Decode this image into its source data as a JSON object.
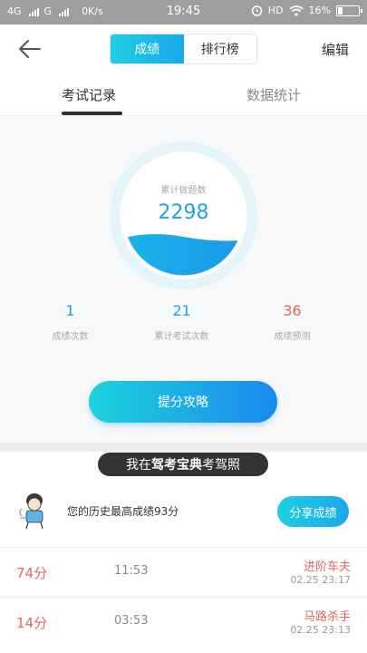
{
  "status": {
    "net1": "4G",
    "net2": "G",
    "speed": "0K/s",
    "time": "19:45",
    "hd": "HD",
    "battery": "16%"
  },
  "header": {
    "tab_scores": "成绩",
    "tab_rank": "排行榜",
    "edit": "编辑"
  },
  "tabs": {
    "exam_records": "考试记录",
    "statistics": "数据统计"
  },
  "gauge": {
    "label": "累计做题数",
    "value": "2298"
  },
  "stats": [
    {
      "value": "1",
      "label": "成绩次数"
    },
    {
      "value": "21",
      "label": "累计考试次数"
    },
    {
      "value": "36",
      "label": "成绩预测"
    }
  ],
  "tips_button": "提分攻略",
  "banner": {
    "prefix": "我在",
    "brand": "驾考宝典",
    "suffix": "考驾照"
  },
  "best": {
    "text": "您的历史最高成绩93分",
    "share": "分享成绩"
  },
  "records": [
    {
      "score": "74分",
      "duration": "11:53",
      "level": "进阶车夫",
      "date": "02.25   23:17"
    },
    {
      "score": "14分",
      "duration": "03:53",
      "level": "马路杀手",
      "date": "02.25   23:13"
    }
  ],
  "colors": {
    "accent": "#1ea4de",
    "warn": "#e0675f"
  }
}
